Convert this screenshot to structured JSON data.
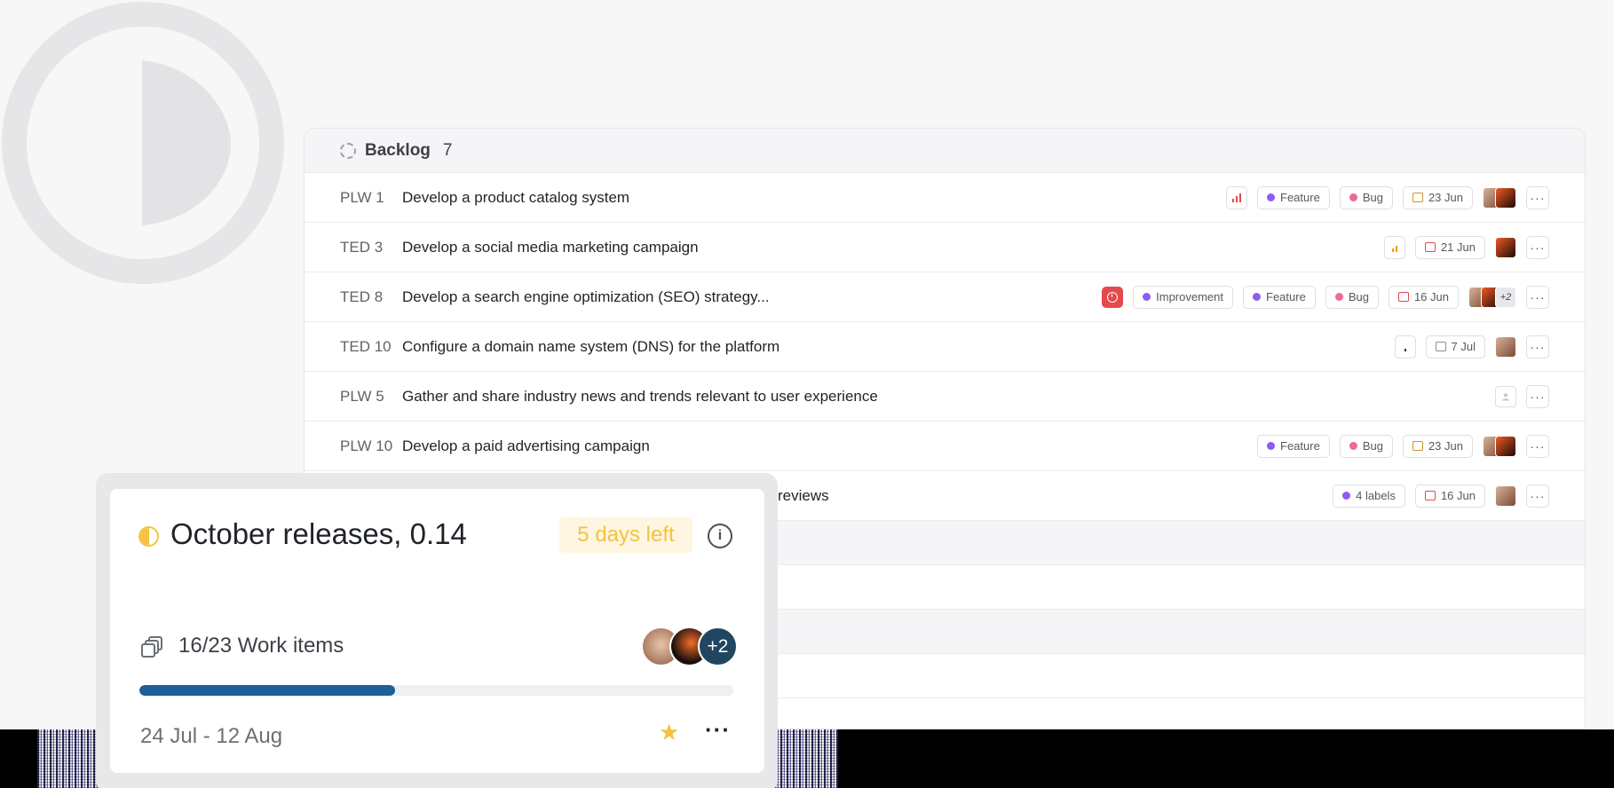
{
  "backlog": {
    "title": "Backlog",
    "count": "7",
    "rows": [
      {
        "id": "PLW 1",
        "title": "Develop a product catalog system",
        "labels": [
          "Feature",
          "Bug"
        ],
        "date": "23 Jun"
      },
      {
        "id": "TED 3",
        "title": "Develop a social media marketing campaign",
        "labels": [],
        "date": "21 Jun"
      },
      {
        "id": "TED 8",
        "title": "Develop a search engine optimization (SEO) strategy...",
        "labels": [
          "Improvement",
          "Feature",
          "Bug"
        ],
        "date": "16 Jun",
        "more_assignees": "+2"
      },
      {
        "id": "TED 10",
        "title": "Configure a domain name system (DNS) for the platform",
        "labels": [],
        "date": "7 Jul"
      },
      {
        "id": "PLW 5",
        "title": "Gather and share industry news and trends relevant to user experience",
        "labels": [],
        "date": ""
      },
      {
        "id": "PLW 10",
        "title": "Develop a paid advertising campaign",
        "labels": [
          "Feature",
          "Bug"
        ],
        "date": "23 Jun"
      },
      {
        "id": "",
        "title": "reviews",
        "labels": [
          "4 labels"
        ],
        "date": "16 Jun"
      }
    ]
  },
  "cycle_card": {
    "title": "October releases, 0.14",
    "days_left": "5 days left",
    "work_items": "16/23 Work items",
    "progress": 0.43,
    "more_members": "+2",
    "date_range": "24 Jul - 12 Aug"
  },
  "colors": {
    "accent_yellow": "#f5c242",
    "progress_blue": "#1d5f99",
    "urgent_red": "#e5484d",
    "label_purple": "#8b5cf6",
    "label_pink": "#ec6a95"
  }
}
